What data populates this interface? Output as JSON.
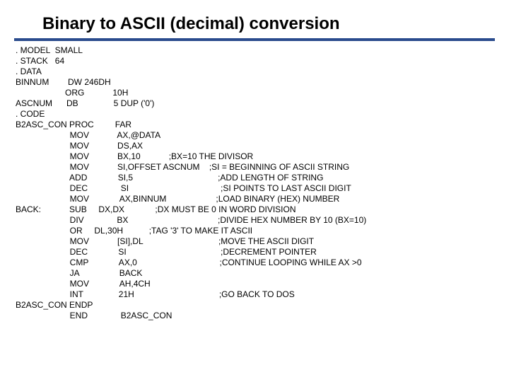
{
  "title": "Binary to ASCII (decimal) conversion",
  "code": ". MODEL  SMALL\n. STACK   64\n. DATA\nBINNUM        DW 246DH\n                     ORG            10H\nASCNUM      DB               5 DUP ('0')\n. CODE\nB2ASC_CON PROC         FAR\n                       MOV            AX,@DATA\n                       MOV            DS,AX\n                       MOV            BX,10            ;BX=10 THE DIVISOR\n                       MOV            SI,OFFSET ASCNUM    ;SI = BEGINNING OF ASCII STRING\n                       ADD             SI,5                                    ;ADD LENGTH OF STRING\n                       DEC              SI                                       ;SI POINTS TO LAST ASCII DIGIT\n                       MOV             AX,BINNUM                     ;LOAD BINARY (HEX) NUMBER\nBACK:            SUB     DX,DX             ;DX MUST BE 0 IN WORD DIVISION\n                       DIV              BX                                      ;DIVIDE HEX NUMBER BY 10 (BX=10)\n                       OR     DL,30H           ;TAG '3' TO MAKE IT ASCII\n                       MOV            [SI],DL                                ;MOVE THE ASCII DIGIT\n                       DEC             SI                                        ;DECREMENT POINTER\n                       CMP             AX,0                                   ;CONTINUE LOOPING WHILE AX >0\n                       JA                 BACK\n                       MOV             AH,4CH\n                       INT               21H                                    ;GO BACK TO DOS\nB2ASC_CON ENDP\n                       END              B2ASC_CON"
}
